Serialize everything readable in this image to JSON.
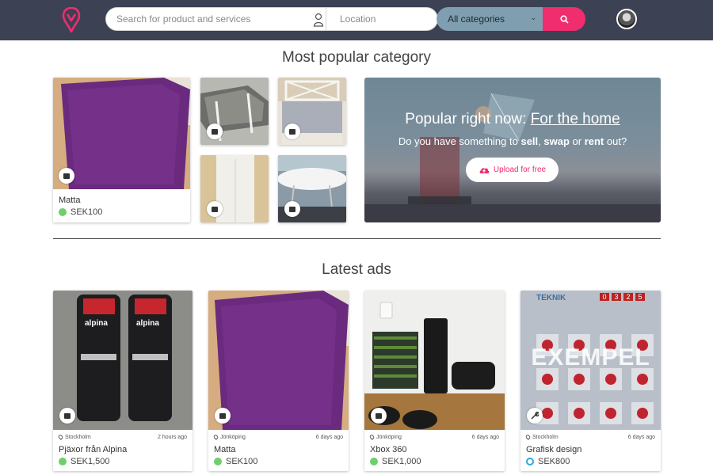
{
  "header": {
    "search_placeholder": "Search for product and services",
    "location_placeholder": "Location",
    "category": "All categories"
  },
  "popular": {
    "title": "Most popular category",
    "featured": {
      "title": "Matta",
      "price": "SEK100"
    },
    "hero": {
      "title_prefix": "Popular right now: ",
      "title_link": "For the home",
      "sub_prefix": "Do you have something to ",
      "sell": "sell",
      "sep1": ", ",
      "swap": "swap",
      "sep2": " or ",
      "rent": "rent",
      "sub_suffix": " out?",
      "upload_label": "Upload for free"
    }
  },
  "latest": {
    "title": "Latest ads",
    "items": [
      {
        "location": "Stockholm",
        "time": "2 hours ago",
        "title": "Pjäxor från Alpina",
        "price": "SEK1,500"
      },
      {
        "location": "Jönköping",
        "time": "6 days ago",
        "title": "Matta",
        "price": "SEK100"
      },
      {
        "location": "Jönköping",
        "time": "6 days ago",
        "title": "Xbox 360",
        "price": "SEK1,000"
      },
      {
        "location": "Stockholm",
        "time": "6 days ago",
        "title": "Grafisk design",
        "price": "SEK800"
      }
    ],
    "grafisk_overlay": "EXEMPEL",
    "grafisk_header": "TEKNIK",
    "grafisk_counter": [
      "0",
      "3",
      "2",
      "5"
    ]
  },
  "colors": {
    "brand_pink": "#ef2d6f",
    "header_bg": "#3d4154",
    "category_bg": "#7f9fb0",
    "coin_green": "#6fcf6f",
    "coin_blue": "#2fa8e0"
  }
}
